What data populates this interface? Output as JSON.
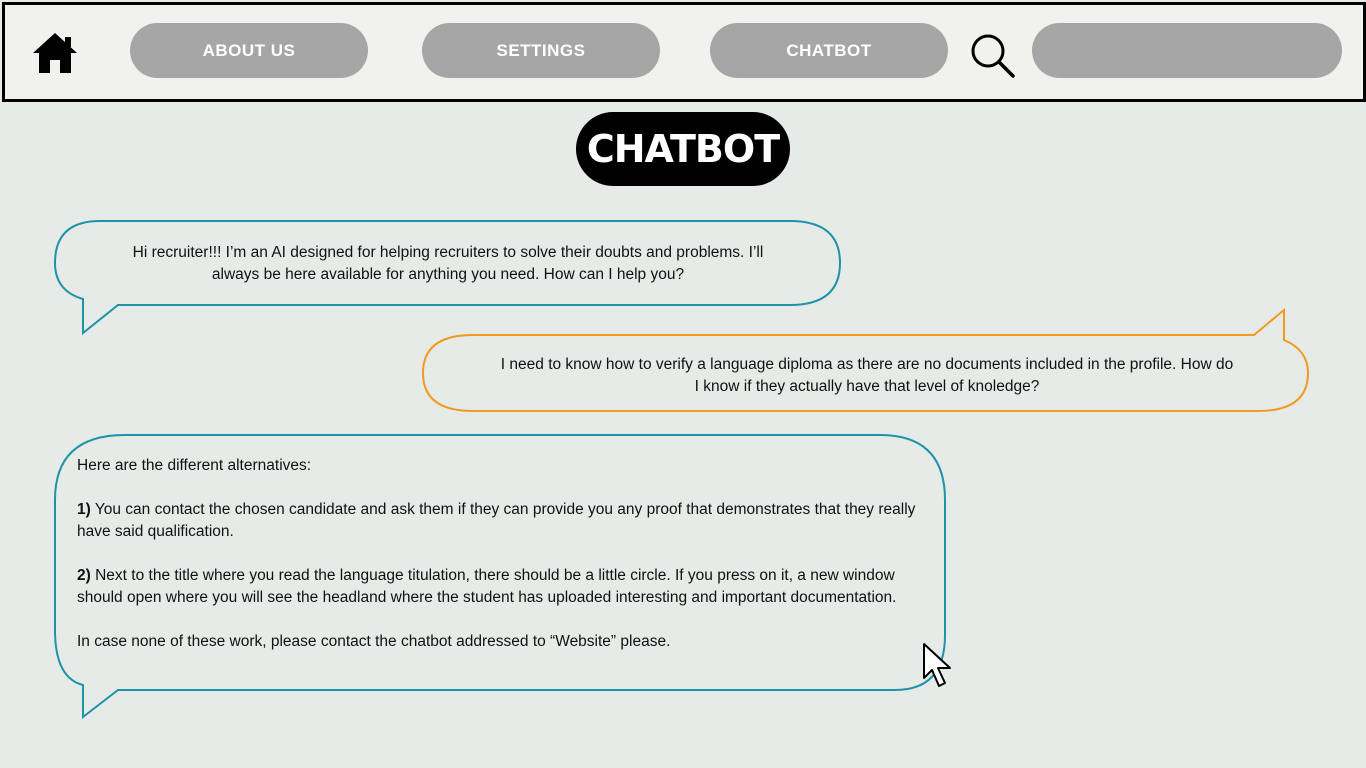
{
  "nav": {
    "home_icon": "home-icon",
    "items": [
      {
        "label": "ABOUT US"
      },
      {
        "label": "SETTINGS"
      },
      {
        "label": "CHATBOT"
      }
    ],
    "search_icon": "search-icon",
    "search_value": ""
  },
  "page_title": "CHATBOT",
  "messages": {
    "bot_greeting": {
      "line1": "Hi recruiter!!! I’m an AI designed for helping recruiters to solve their doubts and problems. I’ll",
      "line2": "always be here available for anything you need. How can I help you?"
    },
    "user_question": {
      "line1": "I need to know how to verify a language diploma as there are no documents included in the profile. How do",
      "line2": "I know if they actually have that level of knoledge?"
    },
    "bot_answer": {
      "intro": "Here are the different alternatives:",
      "item1_number": "1)",
      "item1_text": " You can contact the chosen candidate and ask them if they can provide you any proof that demonstrates that they really have said qualification.",
      "item2_number": "2)",
      "item2_text": " Next to the title where you read the language titulation, there should be a little circle. If you press on it, a new window should open where you will see the headland where the student has uploaded interesting and important documentation.",
      "closing": "In case none of these work, please contact the chatbot addressed to “Website” please."
    }
  },
  "colors": {
    "bot_bubble_border": "#1f93a8",
    "user_bubble_border": "#f09a1f",
    "nav_pill": "#a6a6a6",
    "title_bg": "#000000"
  },
  "cursor_icon": "mouse-pointer-icon"
}
